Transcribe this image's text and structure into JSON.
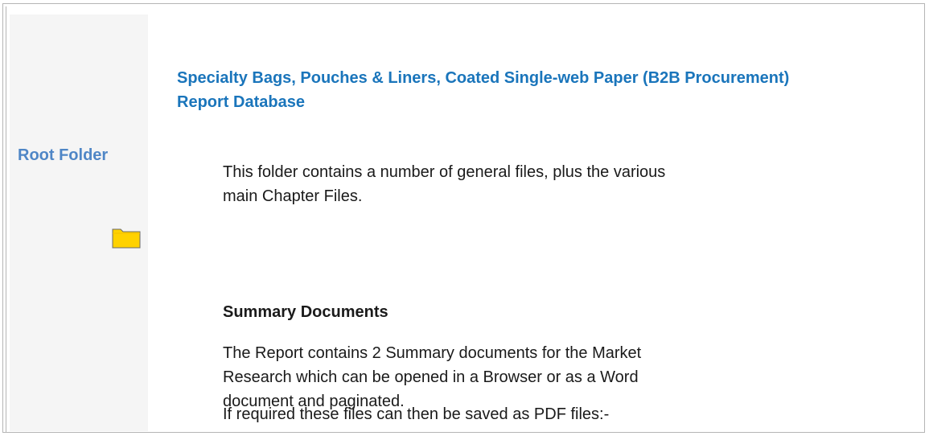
{
  "sidebar": {
    "title": "Root Folder",
    "folder_icon": "folder-icon",
    "folder_color": "#ffd200"
  },
  "main": {
    "title": "Specialty Bags, Pouches & Liners, Coated Single-web Paper (B2B Procurement) Report Database",
    "intro_line1": "This folder contains a number of general files, plus the various",
    "intro_line2": "main Chapter Files.",
    "summary_heading": "Summary Documents",
    "summary_text": "The Report contains 2 Summary documents for the Market Research which can be opened in a Browser or as a Word document and paginated.",
    "pdf_text": "If required these files can then be saved as PDF files:-"
  },
  "colors": {
    "title_blue": "#1a75bb",
    "sidebar_title_blue": "#4f86c6",
    "sidebar_bg": "#f5f5f5",
    "border": "#b5b5b5"
  }
}
